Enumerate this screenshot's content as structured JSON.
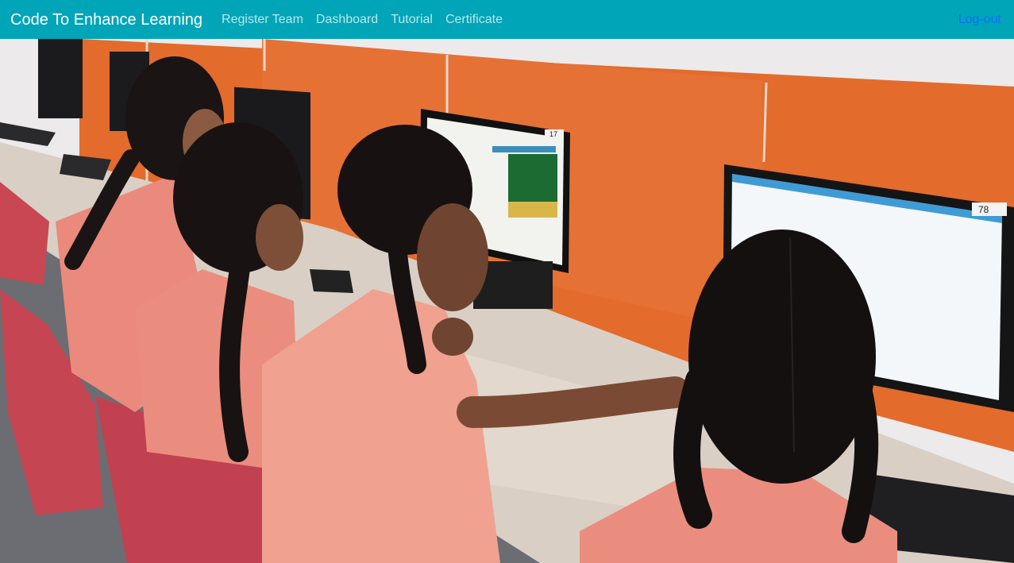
{
  "navbar": {
    "brand": "Code To Enhance Learning",
    "links": [
      {
        "label": "Register Team"
      },
      {
        "label": "Dashboard"
      },
      {
        "label": "Tutorial"
      },
      {
        "label": "Certificate"
      }
    ],
    "logout_label": "Log-out"
  },
  "hero": {
    "monitor_tags": [
      "17",
      "78"
    ]
  },
  "colors": {
    "navbar_bg": "#00a5b8",
    "logout": "#0d6efd",
    "wall": "#e36b2c",
    "uniform": "#e98a7c"
  }
}
